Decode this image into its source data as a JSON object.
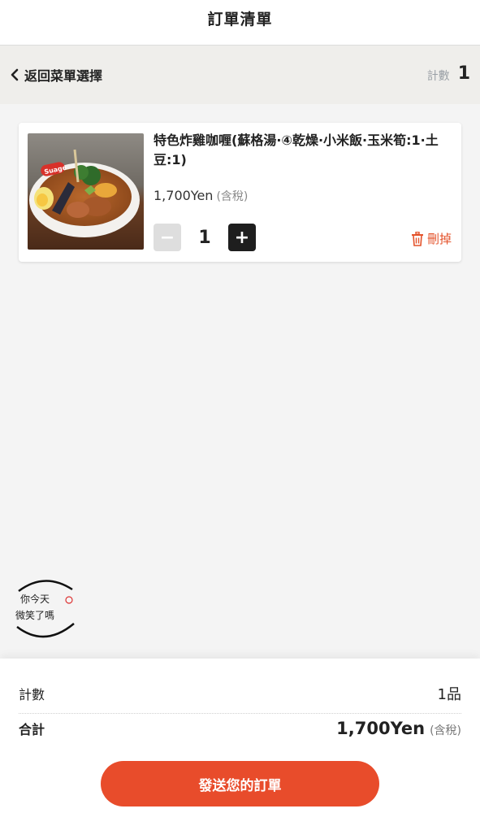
{
  "header": {
    "title": "訂單清單"
  },
  "subbar": {
    "back_label": "返回菜單選擇",
    "count_label": "計數",
    "count_value": "1"
  },
  "item": {
    "name": "特色炸雞咖喱(蘇格湯·④乾燥·小米飯·玉米筍:1·土豆:1)",
    "price": "1,700Yen",
    "tax_note": "(含稅)",
    "quantity": "1",
    "minus_symbol": "−",
    "plus_symbol": "+",
    "delete_label": "刪掉",
    "photo_icon": "soup-curry-photo",
    "photo_badge": "Suage"
  },
  "watermark": {
    "line1": "你今天",
    "line2": "微笑了嗎"
  },
  "summary": {
    "count_label": "計數",
    "count_value": "1品",
    "total_label": "合計",
    "total_value": "1,700Yen",
    "total_tax_note": "(含稅)"
  },
  "submit": {
    "label": "發送您的訂單"
  },
  "colors": {
    "accent": "#e84c2b",
    "dark_button": "#1e1e1e",
    "muted_button": "#dedede"
  }
}
